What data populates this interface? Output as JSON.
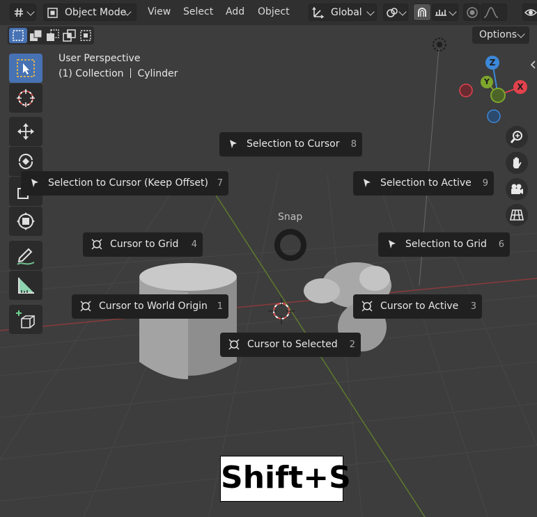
{
  "header": {
    "mode_label": "Object Mode",
    "menus": [
      "View",
      "Select",
      "Add",
      "Object"
    ],
    "transform_orientation": "Global",
    "options_label": "Options"
  },
  "viewport": {
    "perspective_label": "User Perspective",
    "collection_label": "(1) Collection",
    "object_label": "Cylinder"
  },
  "pie_menu": {
    "title": "Snap",
    "items": [
      {
        "label": "Selection to Cursor",
        "key": "8"
      },
      {
        "label": "Selection to Cursor (Keep Offset)",
        "key": "7"
      },
      {
        "label": "Selection to Active",
        "key": "9"
      },
      {
        "label": "Cursor to Grid",
        "key": "4"
      },
      {
        "label": "Selection to Grid",
        "key": "6"
      },
      {
        "label": "Cursor to World Origin",
        "key": "1"
      },
      {
        "label": "Cursor to Active",
        "key": "3"
      },
      {
        "label": "Cursor to Selected",
        "key": "2"
      }
    ]
  },
  "gizmo": {
    "x": "X",
    "y": "Y",
    "z": "Z"
  },
  "shortcut_overlay": "Shift+S",
  "colors": {
    "accent": "#4772b3",
    "axis_x": "#e3424d",
    "axis_y": "#7ea72c",
    "axis_z": "#3c88d8",
    "pie_bg": "#202020"
  },
  "icons": {
    "select_box": "select-box-icon",
    "cursor": "cursor-icon",
    "move": "move-icon",
    "rotate": "rotate-icon",
    "scale": "scale-icon",
    "transform": "transform-icon",
    "annotate": "annotate-icon",
    "measure": "measure-icon",
    "add_cube": "add-cube-icon",
    "zoom": "zoom-icon",
    "hand": "hand-icon",
    "camera": "camera-icon",
    "grid": "grid-icon"
  }
}
